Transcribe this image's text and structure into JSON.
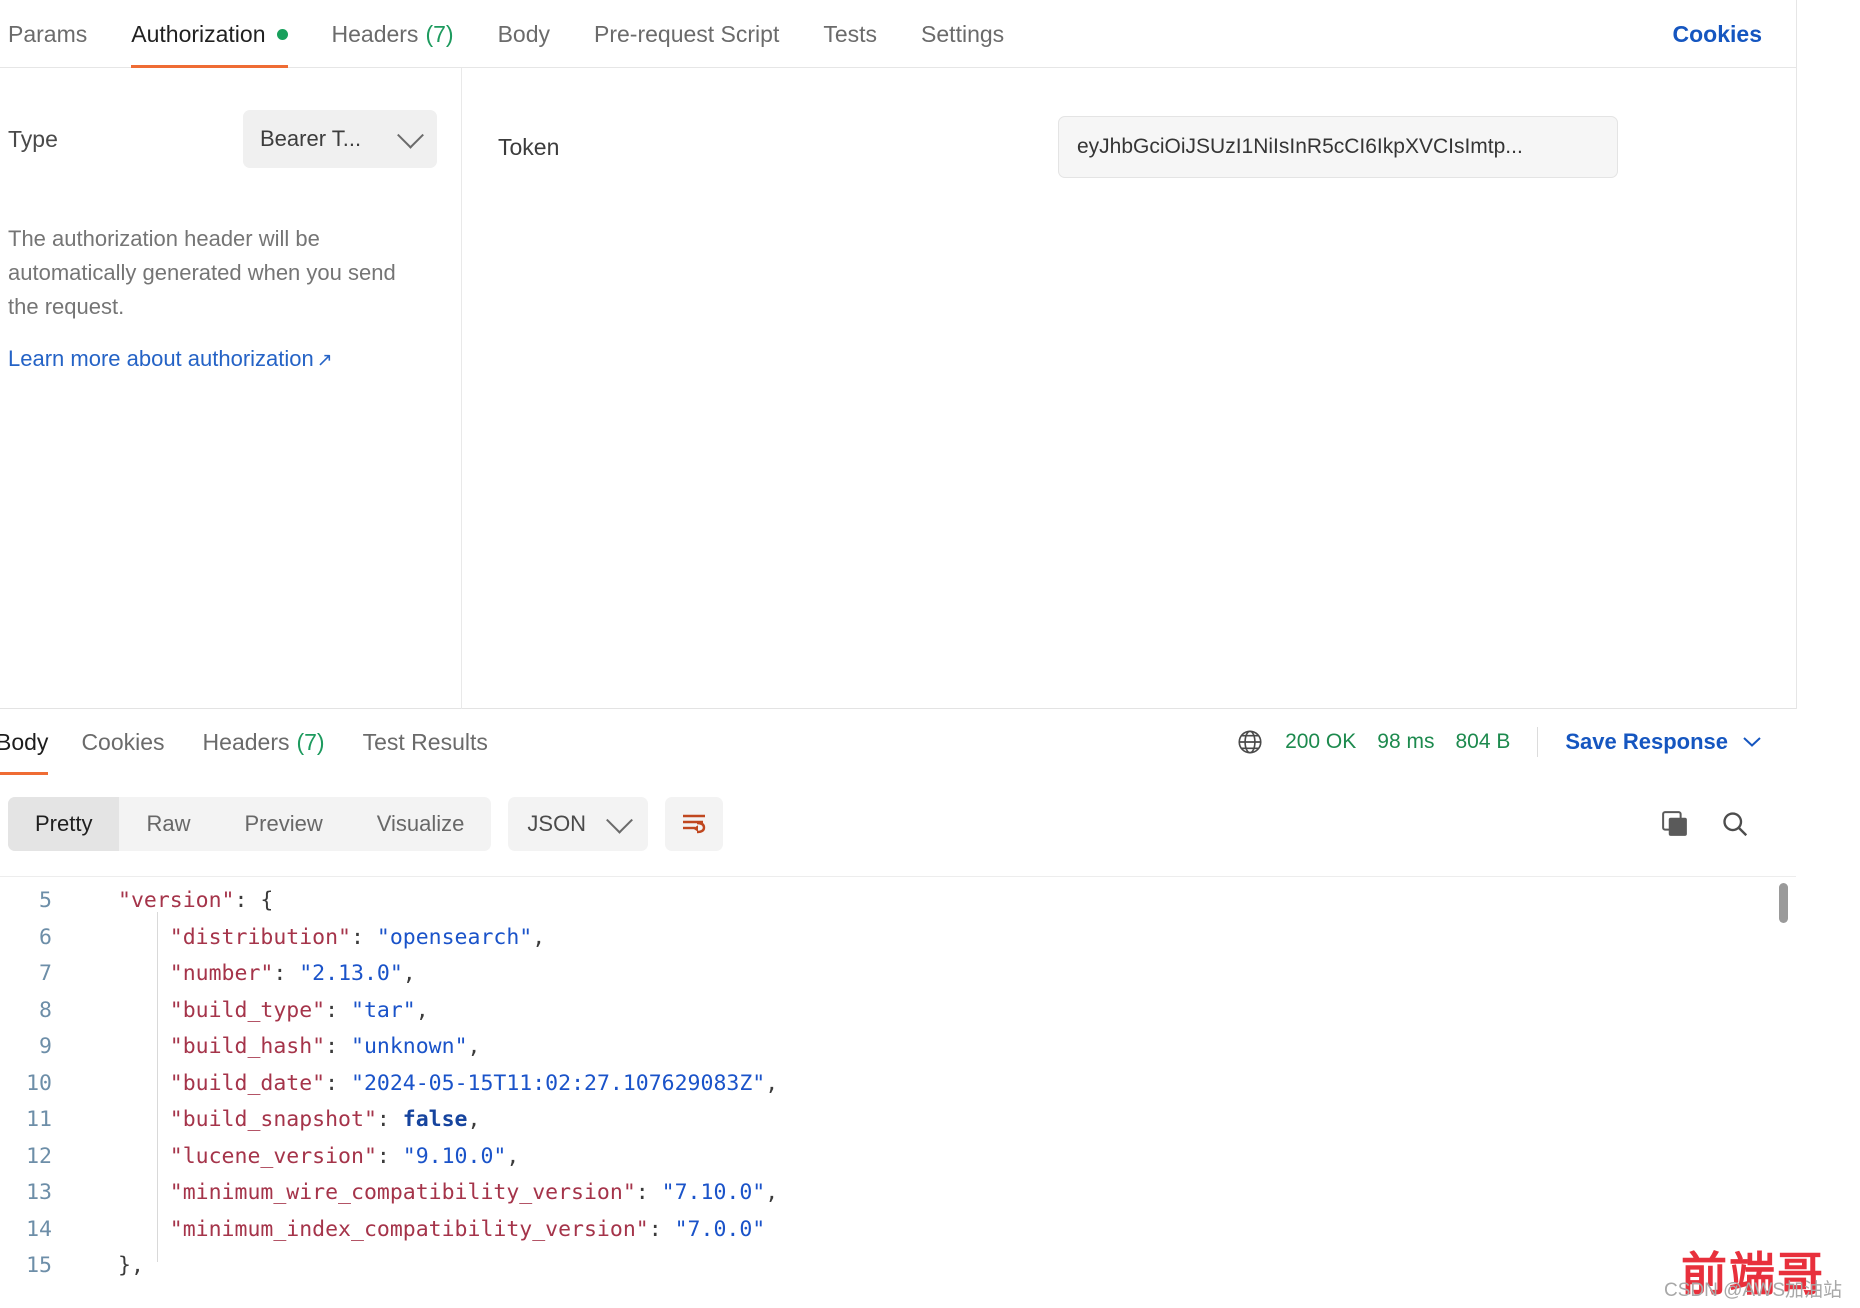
{
  "request_tabs": [
    {
      "label": "Params",
      "active": false,
      "count": null,
      "dot": false
    },
    {
      "label": "Authorization",
      "active": true,
      "count": null,
      "dot": true
    },
    {
      "label": "Headers",
      "active": false,
      "count": "(7)",
      "dot": false
    },
    {
      "label": "Body",
      "active": false,
      "count": null,
      "dot": false
    },
    {
      "label": "Pre-request Script",
      "active": false,
      "count": null,
      "dot": false
    },
    {
      "label": "Tests",
      "active": false,
      "count": null,
      "dot": false
    },
    {
      "label": "Settings",
      "active": false,
      "count": null,
      "dot": false
    }
  ],
  "cookies_link": "Cookies",
  "auth": {
    "type_label": "Type",
    "type_value": "Bearer T...",
    "description": "The authorization header will be automatically generated when you send the request.",
    "learn_more": "Learn more about authorization",
    "external_arrow": "↗",
    "token_label": "Token",
    "token_value": "eyJhbGciOiJSUzI1NiIsInR5cCI6IkpXVCIsImtp...",
    "token_placeholder": "Token"
  },
  "response_tabs": [
    {
      "label": "Body",
      "active": true,
      "count": null
    },
    {
      "label": "Cookies",
      "active": false,
      "count": null
    },
    {
      "label": "Headers",
      "active": false,
      "count": "(7)"
    },
    {
      "label": "Test Results",
      "active": false,
      "count": null
    }
  ],
  "response_meta": {
    "status": "200 OK",
    "time": "98 ms",
    "size": "804 B",
    "save_label": "Save Response"
  },
  "body_toolbar": {
    "views": [
      {
        "label": "Pretty",
        "active": true
      },
      {
        "label": "Raw",
        "active": false
      },
      {
        "label": "Preview",
        "active": false
      },
      {
        "label": "Visualize",
        "active": false
      }
    ],
    "format": "JSON"
  },
  "code": {
    "lines": [
      {
        "no": "5",
        "indent": 0,
        "tokens": [
          {
            "t": "\"version\"",
            "c": "k"
          },
          {
            "t": ": {",
            "c": "p"
          }
        ]
      },
      {
        "no": "6",
        "indent": 1,
        "tokens": [
          {
            "t": "\"distribution\"",
            "c": "k"
          },
          {
            "t": ": ",
            "c": "p"
          },
          {
            "t": "\"opensearch\"",
            "c": "s"
          },
          {
            "t": ",",
            "c": "p"
          }
        ]
      },
      {
        "no": "7",
        "indent": 1,
        "tokens": [
          {
            "t": "\"number\"",
            "c": "k"
          },
          {
            "t": ": ",
            "c": "p"
          },
          {
            "t": "\"2.13.0\"",
            "c": "s"
          },
          {
            "t": ",",
            "c": "p"
          }
        ]
      },
      {
        "no": "8",
        "indent": 1,
        "tokens": [
          {
            "t": "\"build_type\"",
            "c": "k"
          },
          {
            "t": ": ",
            "c": "p"
          },
          {
            "t": "\"tar\"",
            "c": "s"
          },
          {
            "t": ",",
            "c": "p"
          }
        ]
      },
      {
        "no": "9",
        "indent": 1,
        "tokens": [
          {
            "t": "\"build_hash\"",
            "c": "k"
          },
          {
            "t": ": ",
            "c": "p"
          },
          {
            "t": "\"unknown\"",
            "c": "s"
          },
          {
            "t": ",",
            "c": "p"
          }
        ]
      },
      {
        "no": "10",
        "indent": 1,
        "tokens": [
          {
            "t": "\"build_date\"",
            "c": "k"
          },
          {
            "t": ": ",
            "c": "p"
          },
          {
            "t": "\"2024-05-15T11:02:27.107629083Z\"",
            "c": "s"
          },
          {
            "t": ",",
            "c": "p"
          }
        ]
      },
      {
        "no": "11",
        "indent": 1,
        "tokens": [
          {
            "t": "\"build_snapshot\"",
            "c": "k"
          },
          {
            "t": ": ",
            "c": "p"
          },
          {
            "t": "false",
            "c": "b"
          },
          {
            "t": ",",
            "c": "p"
          }
        ]
      },
      {
        "no": "12",
        "indent": 1,
        "tokens": [
          {
            "t": "\"lucene_version\"",
            "c": "k"
          },
          {
            "t": ": ",
            "c": "p"
          },
          {
            "t": "\"9.10.0\"",
            "c": "s"
          },
          {
            "t": ",",
            "c": "p"
          }
        ]
      },
      {
        "no": "13",
        "indent": 1,
        "tokens": [
          {
            "t": "\"minimum_wire_compatibility_version\"",
            "c": "k"
          },
          {
            "t": ": ",
            "c": "p"
          },
          {
            "t": "\"7.10.0\"",
            "c": "s"
          },
          {
            "t": ",",
            "c": "p"
          }
        ]
      },
      {
        "no": "14",
        "indent": 1,
        "tokens": [
          {
            "t": "\"minimum_index_compatibility_version\"",
            "c": "k"
          },
          {
            "t": ": ",
            "c": "p"
          },
          {
            "t": "\"7.0.0\"",
            "c": "s"
          }
        ]
      },
      {
        "no": "15",
        "indent": 0,
        "tokens": [
          {
            "t": "},",
            "c": "p"
          }
        ]
      }
    ]
  },
  "watermark": {
    "main": "前端哥",
    "sub": "CSDN @AWS加油站"
  },
  "colors": {
    "accent_orange": "#ef6c34",
    "link_blue": "#1556c0",
    "status_green": "#1d8a4e",
    "key_red": "#a5344a",
    "string_blue": "#1a53c9"
  }
}
